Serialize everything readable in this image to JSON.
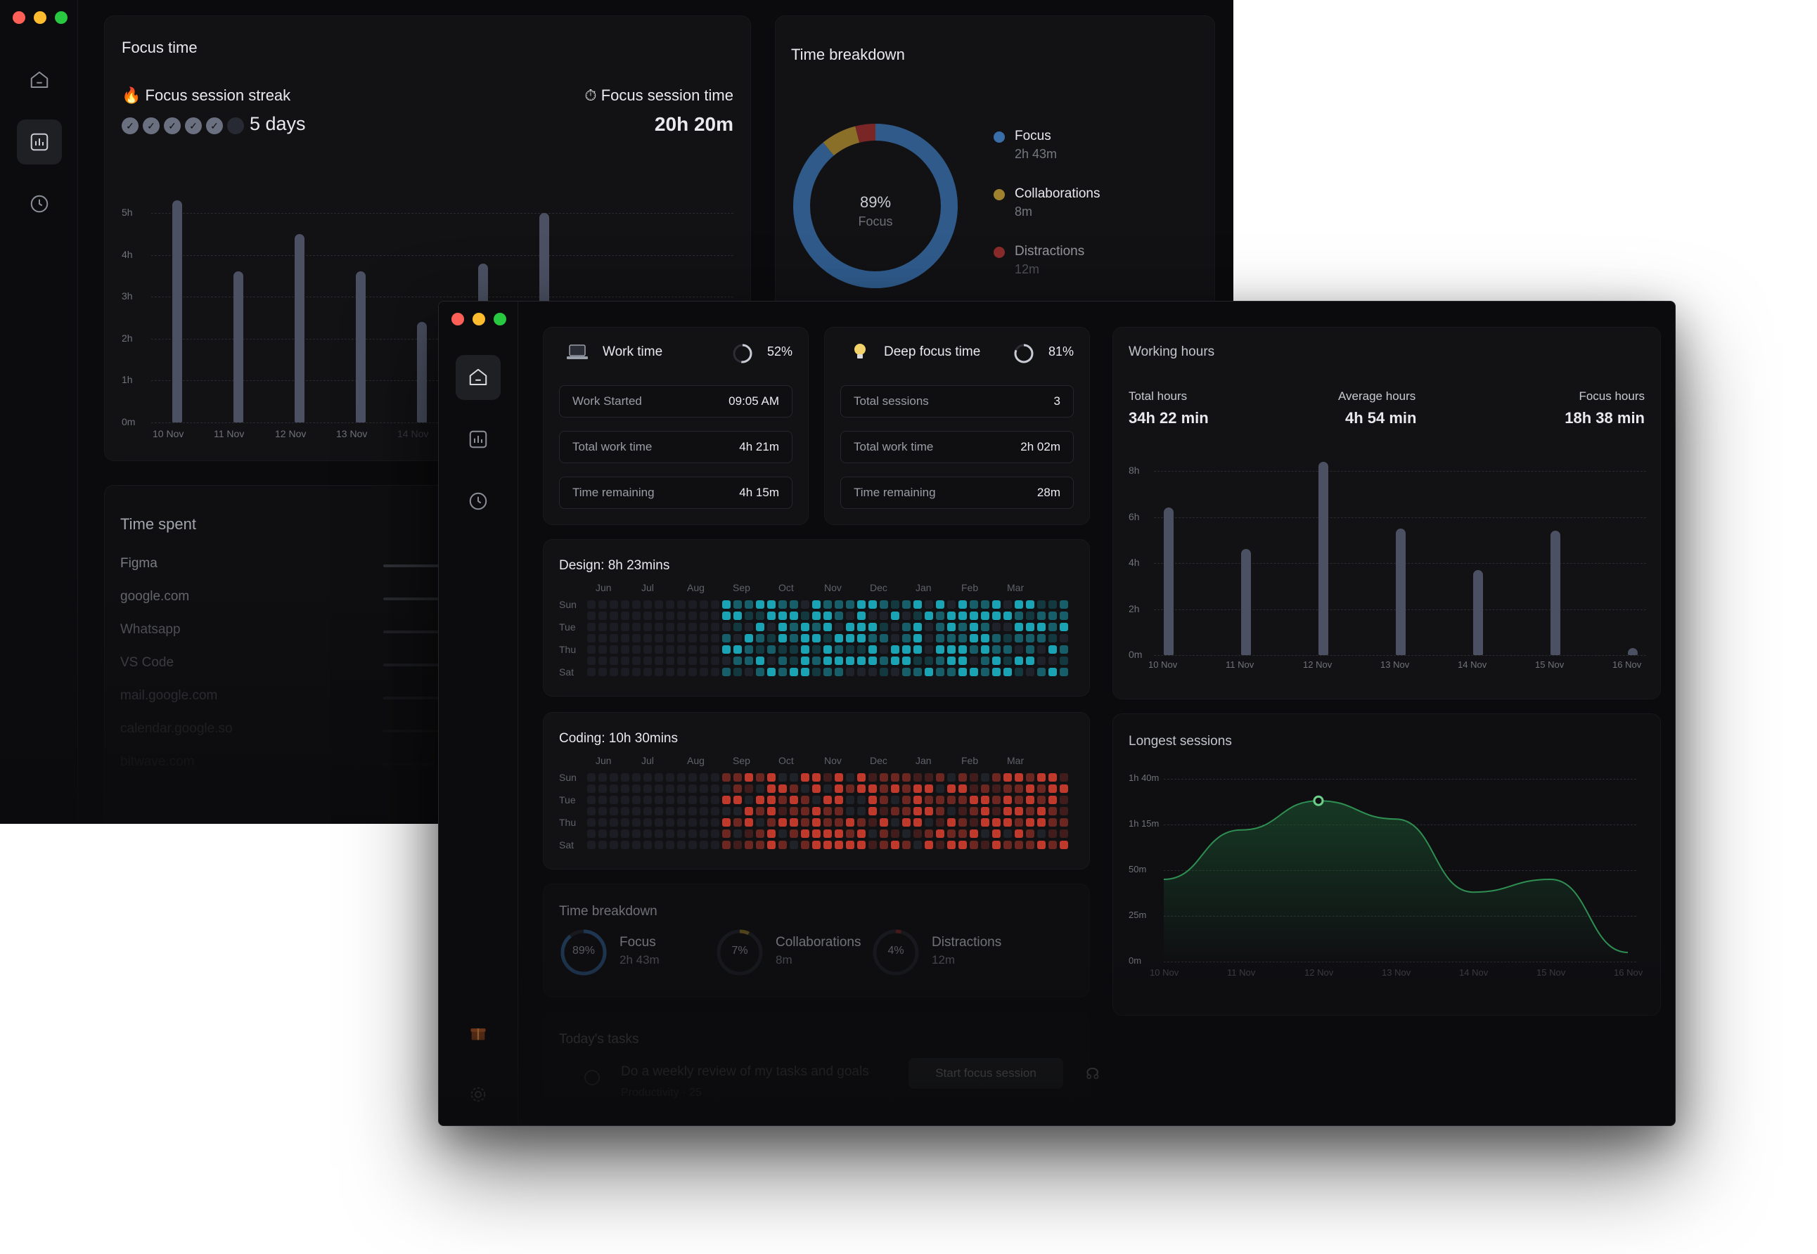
{
  "back_window": {
    "focus_time": {
      "title": "Focus time",
      "streak_label": "Focus session streak",
      "streak_value": "5 days",
      "streak_checks": 5,
      "streak_total": 6,
      "session_time_label": "Focus session time",
      "session_time_value": "20h 20m"
    },
    "focus_chart": {
      "y_ticks": [
        "5h",
        "4h",
        "3h",
        "2h",
        "1h",
        "0m"
      ],
      "x_labels": [
        "10 Nov",
        "11 Nov",
        "12 Nov",
        "13 Nov",
        "14 Nov"
      ]
    },
    "time_breakdown": {
      "title": "Time breakdown",
      "center_value": "89%",
      "center_label": "Focus",
      "items": [
        {
          "name": "Focus",
          "value": "2h 43m",
          "color": "#3a6ea8"
        },
        {
          "name": "Collaborations",
          "value": "8m",
          "color": "#a0822e"
        },
        {
          "name": "Distractions",
          "value": "12m",
          "color": "#8b2b2b"
        }
      ]
    },
    "time_spent": {
      "title": "Time spent",
      "apps": [
        "Figma",
        "google.com",
        "Whatsapp",
        "VS Code",
        "mail.google.com",
        "calendar.google.so",
        "bitwave.com"
      ]
    }
  },
  "front_window": {
    "work_time": {
      "title": "Work time",
      "percent": "52%",
      "rows": [
        {
          "label": "Work Started",
          "value": "09:05 AM"
        },
        {
          "label": "Total work time",
          "value": "4h 21m"
        },
        {
          "label": "Time remaining",
          "value": "4h 15m"
        }
      ]
    },
    "deep_focus": {
      "title": "Deep focus time",
      "percent": "81%",
      "rows": [
        {
          "label": "Total sessions",
          "value": "3"
        },
        {
          "label": "Total work time",
          "value": "2h 02m"
        },
        {
          "label": "Time remaining",
          "value": "28m"
        }
      ]
    },
    "design_heatmap": {
      "title": "Design: 8h 23mins",
      "months": [
        "Jun",
        "Jul",
        "Aug",
        "Sep",
        "Oct",
        "Nov",
        "Dec",
        "Jan",
        "Feb",
        "Mar"
      ],
      "days": [
        "Sun",
        "Tue",
        "Thu",
        "Sat"
      ],
      "color": "#1aa3b5"
    },
    "coding_heatmap": {
      "title": "Coding: 10h 30mins",
      "months": [
        "Jun",
        "Jul",
        "Aug",
        "Sep",
        "Oct",
        "Nov",
        "Dec",
        "Jan",
        "Feb",
        "Mar"
      ],
      "days": [
        "Sun",
        "Tue",
        "Thu",
        "Sat"
      ],
      "color": "#c0392b"
    },
    "time_breakdown": {
      "title": "Time breakdown",
      "items": [
        {
          "pct": "89%",
          "name": "Focus",
          "value": "2h 43m"
        },
        {
          "pct": "7%",
          "name": "Collaborations",
          "value": "8m"
        },
        {
          "pct": "4%",
          "name": "Distractions",
          "value": "12m"
        }
      ]
    },
    "todays_tasks": {
      "title": "Today's tasks",
      "task": "Do a weekly review of my tasks and goals",
      "task_sub": "Productivity · 25",
      "start_button": "Start focus session"
    },
    "working_hours": {
      "title": "Working hours",
      "total_label": "Total hours",
      "total_value": "34h 22 min",
      "avg_label": "Average hours",
      "avg_value": "4h 54 min",
      "focus_label": "Focus hours",
      "focus_value": "18h 38 min",
      "y_ticks": [
        "8h",
        "6h",
        "4h",
        "2h",
        "0m"
      ]
    },
    "longest_sessions": {
      "title": "Longest sessions",
      "y_ticks": [
        "1h 40m",
        "1h 15m",
        "50m",
        "25m",
        "0m"
      ]
    }
  },
  "chart_data": [
    {
      "type": "bar",
      "title": "Focus time",
      "categories": [
        "10 Nov",
        "11 Nov",
        "12 Nov",
        "13 Nov",
        "14 Nov",
        "15 Nov",
        "16 Nov"
      ],
      "values": [
        5.3,
        3.6,
        4.5,
        3.6,
        2.4,
        3.8,
        5.0
      ],
      "ylim": [
        0,
        5.5
      ]
    },
    {
      "type": "pie",
      "title": "Time breakdown",
      "categories": [
        "Focus",
        "Collaborations",
        "Distractions"
      ],
      "values": [
        89,
        7,
        4
      ]
    },
    {
      "type": "bar",
      "title": "Working hours",
      "categories": [
        "10 Nov",
        "11 Nov",
        "12 Nov",
        "13 Nov",
        "14 Nov",
        "15 Nov",
        "16 Nov"
      ],
      "values": [
        6.4,
        4.6,
        8.4,
        5.5,
        3.7,
        5.4,
        0.3
      ],
      "ylim": [
        0,
        8
      ]
    },
    {
      "type": "line",
      "title": "Longest sessions",
      "categories": [
        "10 Nov",
        "11 Nov",
        "12 Nov",
        "13 Nov",
        "14 Nov",
        "15 Nov",
        "16 Nov"
      ],
      "values": [
        45,
        72,
        88,
        78,
        38,
        45,
        5
      ],
      "ylim": [
        0,
        100
      ]
    }
  ]
}
